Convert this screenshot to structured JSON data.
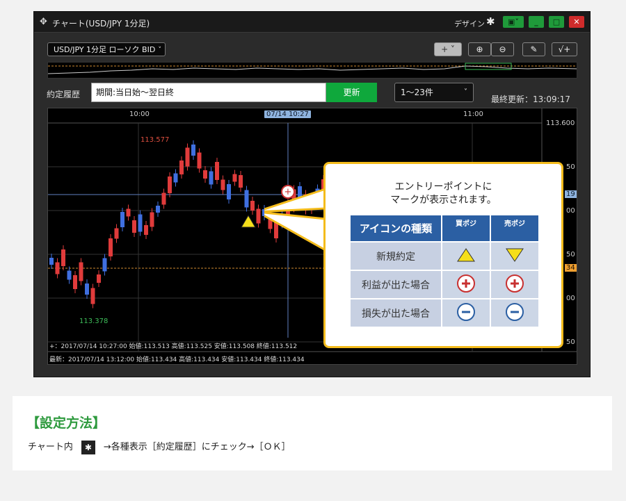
{
  "window": {
    "title": "チャート(USD/JPY 1分足)",
    "design_label": "デザイン",
    "icons": [
      "move-icon",
      "gear-icon",
      "layout-icon",
      "minimize-icon",
      "maximize-icon",
      "close-icon"
    ],
    "accent_green": "#1f9a3a",
    "close_red": "#cf2b2b"
  },
  "toolbar": {
    "symbol_select": "USD/JPY 1分足 ローソク BID",
    "tools": [
      "crosshair-icon",
      "zoom-in-icon",
      "zoom-out-icon",
      "pencil-icon",
      "indicator-icon"
    ]
  },
  "history": {
    "label": "約定履歴",
    "period": "期間:当日始～翌日終",
    "update_button": "更新",
    "range_select": "1～23件",
    "last_update": "最終更新：13:09:17",
    "update_color": "#0fa83c"
  },
  "chart": {
    "x_labels": [
      "10:00",
      "07/14 10:27",
      "11:00"
    ],
    "y_labels": [
      "113.600",
      "50",
      "19",
      "00",
      "50",
      "34",
      "00",
      "50"
    ],
    "high_label": "113.577",
    "low_label": "113.378",
    "info_line1": "+：2017/07/14 10:27:00  始値:113.513  高値:113.525  安値:113.508  終値:113.512",
    "info_line2": "最新：2017/07/14 13:12:00  始値:113.434  高値:113.434  安値:113.434  終値:113.434",
    "up_color": "#e03b3b",
    "down_color": "#3f6fe0"
  },
  "callout": {
    "message_line1": "エントリーポイントに",
    "message_line2": "マークが表示されます。",
    "header": [
      "アイコンの種類",
      "買ポジ",
      "売ポジ"
    ],
    "rows": [
      {
        "label": "新規約定",
        "buy_icon": "triangle-up-icon",
        "sell_icon": "triangle-down-icon"
      },
      {
        "label": "利益が出た場合",
        "buy_icon": "plus-circle-icon",
        "sell_icon": "plus-circle-icon"
      },
      {
        "label": "損失が出た場合",
        "buy_icon": "minus-circle-icon",
        "sell_icon": "minus-circle-icon"
      }
    ],
    "border_color": "#f4bc1c"
  },
  "note": {
    "title": "【設定方法】",
    "text_before": "チャート内",
    "text_after": "→各種表示［約定履歴］にチェック→［ＯＫ］"
  }
}
